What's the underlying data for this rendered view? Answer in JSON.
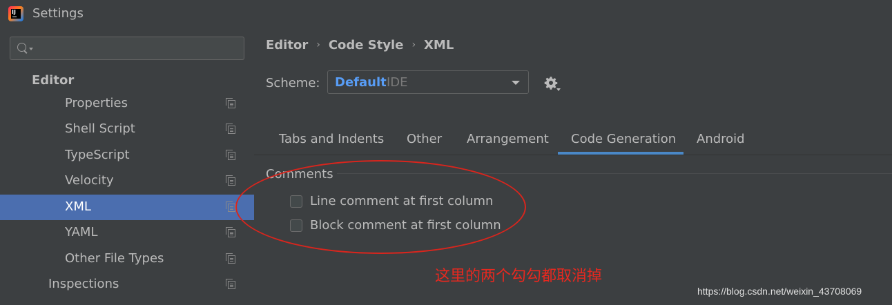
{
  "window": {
    "title": "Settings"
  },
  "search": {
    "placeholder": ""
  },
  "sidebar": {
    "items": [
      {
        "label": "Editor"
      },
      {
        "label": "Properties"
      },
      {
        "label": "Shell Script"
      },
      {
        "label": "TypeScript"
      },
      {
        "label": "Velocity"
      },
      {
        "label": "XML"
      },
      {
        "label": "YAML"
      },
      {
        "label": "Other File Types"
      },
      {
        "label": "Inspections"
      }
    ],
    "selected": "XML"
  },
  "breadcrumb": {
    "items": [
      "Editor",
      "Code Style",
      "XML"
    ],
    "separator": "›"
  },
  "scheme": {
    "label": "Scheme:",
    "name": "Default",
    "kind": "IDE"
  },
  "tabs": {
    "items": [
      "Tabs and Indents",
      "Other",
      "Arrangement",
      "Code Generation",
      "Android"
    ],
    "active": "Code Generation"
  },
  "comments": {
    "title": "Comments",
    "options": [
      {
        "label": "Line comment at first column",
        "checked": false
      },
      {
        "label": "Block comment at first column",
        "checked": false
      }
    ]
  },
  "annotation": {
    "text": "这里的两个勾勾都取消掉",
    "color": "#e8281f"
  },
  "watermark": {
    "text": "https://blog.csdn.net/weixin_43708069"
  },
  "colors": {
    "selection": "#4b6eaf",
    "scheme_name": "#589df6",
    "tab_underline": "#4a88c7",
    "annotation": "#d9251d"
  }
}
